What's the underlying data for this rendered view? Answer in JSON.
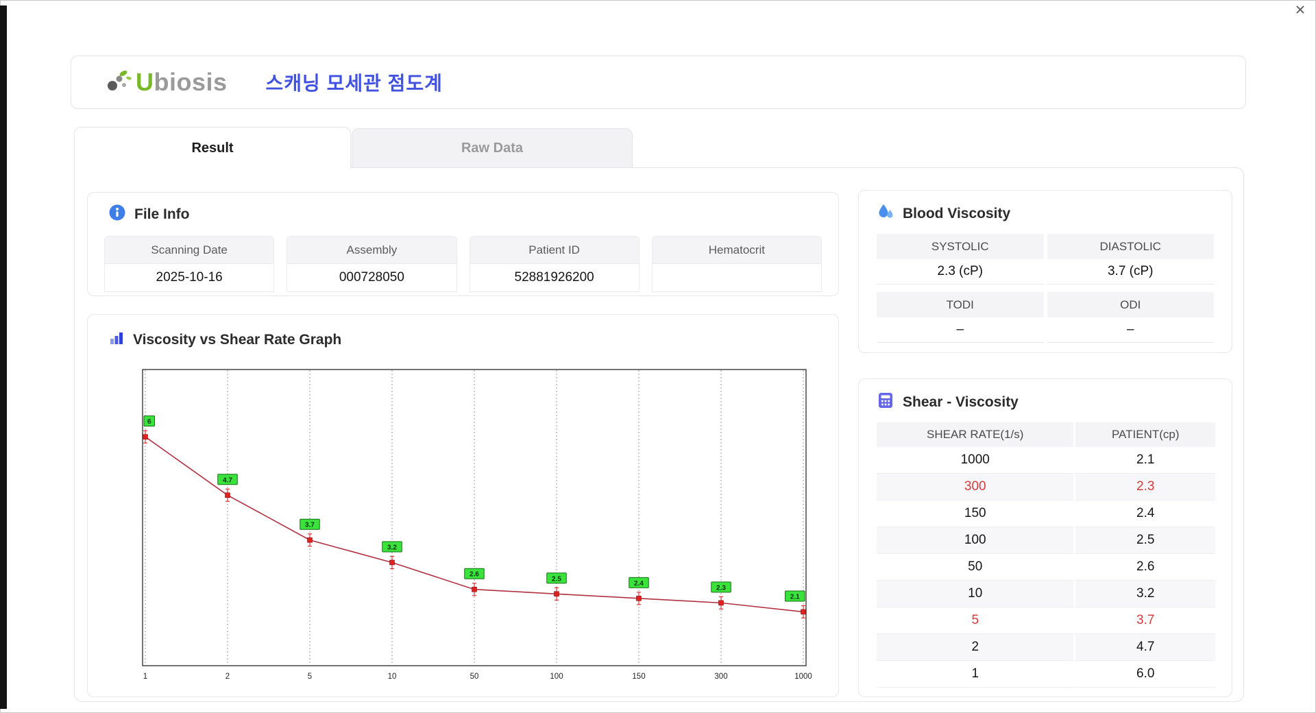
{
  "header": {
    "logo_u": "U",
    "logo_rest": "biosis",
    "title_ko": "스캐닝 모세관 점도계"
  },
  "tabs": [
    {
      "label": "Result",
      "active": true
    },
    {
      "label": "Raw Data",
      "active": false
    }
  ],
  "file_info": {
    "title": "File Info",
    "fields": [
      {
        "label": "Scanning Date",
        "value": "2025-10-16"
      },
      {
        "label": "Assembly",
        "value": "000728050"
      },
      {
        "label": "Patient ID",
        "value": "52881926200"
      },
      {
        "label": "Hematocrit",
        "value": ""
      }
    ]
  },
  "graph_section": {
    "title": "Viscosity vs Shear Rate Graph"
  },
  "chart_data": {
    "type": "line",
    "title": "Viscosity vs Shear Rate Graph",
    "categories": [
      1,
      2,
      5,
      10,
      50,
      100,
      150,
      300,
      1000
    ],
    "x_tick_labels": [
      "1",
      "2",
      "5",
      "10",
      "50",
      "100",
      "150",
      "300",
      "1000"
    ],
    "series": [
      {
        "name": "PATIENT(cp)",
        "values": [
          6.0,
          4.7,
          3.7,
          3.2,
          2.6,
          2.5,
          2.4,
          2.3,
          2.1
        ]
      }
    ],
    "point_labels": [
      "6",
      "4.7",
      "3.7",
      "3.2",
      "2.6",
      "2.5",
      "2.4",
      "2.3",
      "2.1"
    ],
    "xlabel": "",
    "ylabel": "",
    "ylim": [
      0.9,
      7.5
    ],
    "x_spacing": "equal-interval-category",
    "grid": "vertical-dashed",
    "legend": "none",
    "line_color": "#b13141",
    "marker_color": "#e12120",
    "point_label_bg": "#3ce23c",
    "point_label_border": "#156e15"
  },
  "blood_viscosity": {
    "title": "Blood Viscosity",
    "cells": [
      {
        "label": "SYSTOLIC",
        "value": "2.3 (cP)"
      },
      {
        "label": "DIASTOLIC",
        "value": "3.7 (cP)"
      },
      {
        "label": "TODI",
        "value": "–"
      },
      {
        "label": "ODI",
        "value": "–"
      }
    ]
  },
  "shear_viscosity": {
    "title": "Shear - Viscosity",
    "columns": [
      "SHEAR RATE(1/s)",
      "PATIENT(cp)"
    ],
    "rows": [
      {
        "shear_rate": "1000",
        "patient": "2.1",
        "highlight": false
      },
      {
        "shear_rate": "300",
        "patient": "2.3",
        "highlight": true
      },
      {
        "shear_rate": "150",
        "patient": "2.4",
        "highlight": false
      },
      {
        "shear_rate": "100",
        "patient": "2.5",
        "highlight": false
      },
      {
        "shear_rate": "50",
        "patient": "2.6",
        "highlight": false
      },
      {
        "shear_rate": "10",
        "patient": "3.2",
        "highlight": false
      },
      {
        "shear_rate": "5",
        "patient": "3.7",
        "highlight": true
      },
      {
        "shear_rate": "2",
        "patient": "4.7",
        "highlight": false
      },
      {
        "shear_rate": "1",
        "patient": "6.0",
        "highlight": false
      }
    ]
  },
  "colors": {
    "accent_blue": "#4152e0",
    "logo_green": "#79b829",
    "logo_gray": "#9a9a9a",
    "highlight_red": "#d63b3b",
    "icon_blue": "#3f7de8",
    "icon_indigo": "#6467e8"
  },
  "icons": [
    "close-icon",
    "ubiosis-logo-icon",
    "info-icon",
    "bar-chart-icon",
    "droplets-icon",
    "calculator-icon"
  ]
}
